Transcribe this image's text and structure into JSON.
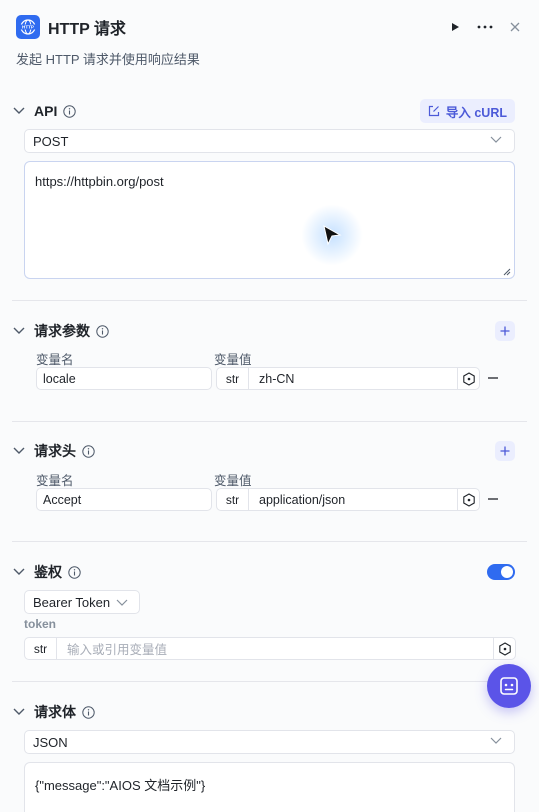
{
  "header": {
    "icon_text": "HTTP",
    "title": "HTTP 请求",
    "subtitle": "发起 HTTP 请求并使用响应结果"
  },
  "api": {
    "title": "API",
    "import_label": "导入 cURL",
    "method": "POST",
    "url": "https://httpbin.org/post"
  },
  "params": {
    "title": "请求参数",
    "name_col": "变量名",
    "value_col": "变量值",
    "rows": [
      {
        "name": "locale",
        "type": "str",
        "value": "zh-CN"
      }
    ]
  },
  "headers": {
    "title": "请求头",
    "name_col": "变量名",
    "value_col": "变量值",
    "rows": [
      {
        "name": "Accept",
        "type": "str",
        "value": "application/json"
      }
    ]
  },
  "auth": {
    "title": "鉴权",
    "enabled": true,
    "type": "Bearer Token",
    "token_label": "token",
    "token_type": "str",
    "token_placeholder": "输入或引用变量值"
  },
  "body": {
    "title": "请求体",
    "format": "JSON",
    "content": "{\"message\":\"AIOS 文档示例\"}"
  },
  "colors": {
    "accent": "#2f6bf0",
    "fab": "#5b54e8",
    "import_text": "#4c5ad8"
  }
}
